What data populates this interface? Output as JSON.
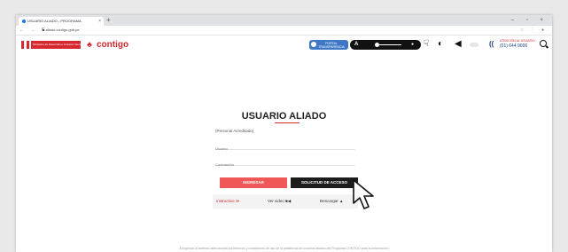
{
  "browser": {
    "tab_title": "USUARIO ALIADO - PROGRAMA",
    "tab_close": "×",
    "new_tab": "+",
    "window_controls": "– ▫ ×",
    "nav_buttons": "← → C",
    "url": "■ aliado.contigo.gob.pe",
    "address_right": "☆ ⋮ ●"
  },
  "header": {
    "gob_text": "Ministerio de Desarrollo e Inclusión Social",
    "logo_icon": "people-icon",
    "logo_text": "contigo",
    "portal_label": "PORTAL TRANSPARENCIA",
    "a11y_label": "A",
    "a11y_zoom": "●",
    "contrast_icon": "◐",
    "audio_icon": "◀",
    "phone_icon": "((",
    "phone_label": "ATENCIÓN AL USUARIO",
    "phone_number": "(01) 644 9006"
  },
  "main": {
    "title": "USUARIO ALIADO",
    "subtitle": "(Personal Acreditado)",
    "user_placeholder": "Usuario",
    "password_placeholder": "Contraseña",
    "login_button": "INGRESAR",
    "access_button": "SOLICITUD DE ACCESO",
    "link_instructions": "Instructivo ≫",
    "link_video": "Ver video ■◀",
    "link_download": "Descargar ▲"
  },
  "footer": {
    "text": "Al ingresar al sistema usted acepta los términos y condiciones de uso de la plataforma de usuarios aliados del Programa CONTIGO para su información"
  },
  "colors": {
    "brand_red": "#d7282f",
    "login_button": "#f05858",
    "access_button": "#1c1c1c",
    "portal_blue": "#3f77c4"
  }
}
